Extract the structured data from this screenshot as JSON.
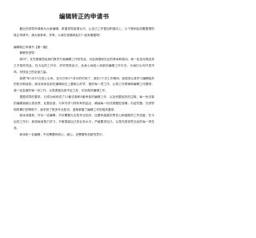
{
  "document": {
    "title": "编辑转正的申请书",
    "intro": "最近的领导申请就为大家编辑，希望领导能够认可，让自己工作更加积极向上，以下是网友收集整理的转正申请书，请大家参考，学考，以我们准确网友们一起来看看吧！",
    "section_heading": "编辑转正申请书【第一篇】",
    "salutation": "尊敬的领导：",
    "paragraphs": [
      "我叫*，在先感谢您给我们数学方面编辑工作的机会，对此我感到无比的荣幸和激动。我一定会珍惜这来之不易的机会，在今后的工作中，好好表现自己，全身心地投入到新的编辑工作中去，为我们公司开发市场，尽快自己的全部力量。",
      "我是*年5月11日进入公司，至今已有3个多月的时间了，我在5个月工作期间，我虽然认真学习编辑相关的知识和经验，我深深体会到在编辑岗位上要耐心好学，做好每一项工作，认真工作规律和编辑工作要领，我一定会做好每一份工作，认真提高自身不足之处，切实做好编辑工作。",
      "根据领导的要求，已成功地完成了15套试卷和4套考卷的编辑工作，以及完善相关的注释，每一份试卷的编辑我都认真负责，反复检查，与本刊学习材料有机结合，确保每一份试卷题型准确，内容完整，在领导和同事们的帮助下，我学到了很多专业知识，逐渐掌握了编辑工作的相关要求。",
      "我深深感到，作为一名编辑，不仅需要扎实的专业知识，还要有高度的责任心和细致的工作态度。在今后的工作中，我将继续努力学习，不断提高自己的业务水平，严格要求自己，认真完成领导交给的每一项任务。",
      "我深知一名编辑，不仅需要有耐心，细心，还需要有创新的意识..."
    ]
  }
}
